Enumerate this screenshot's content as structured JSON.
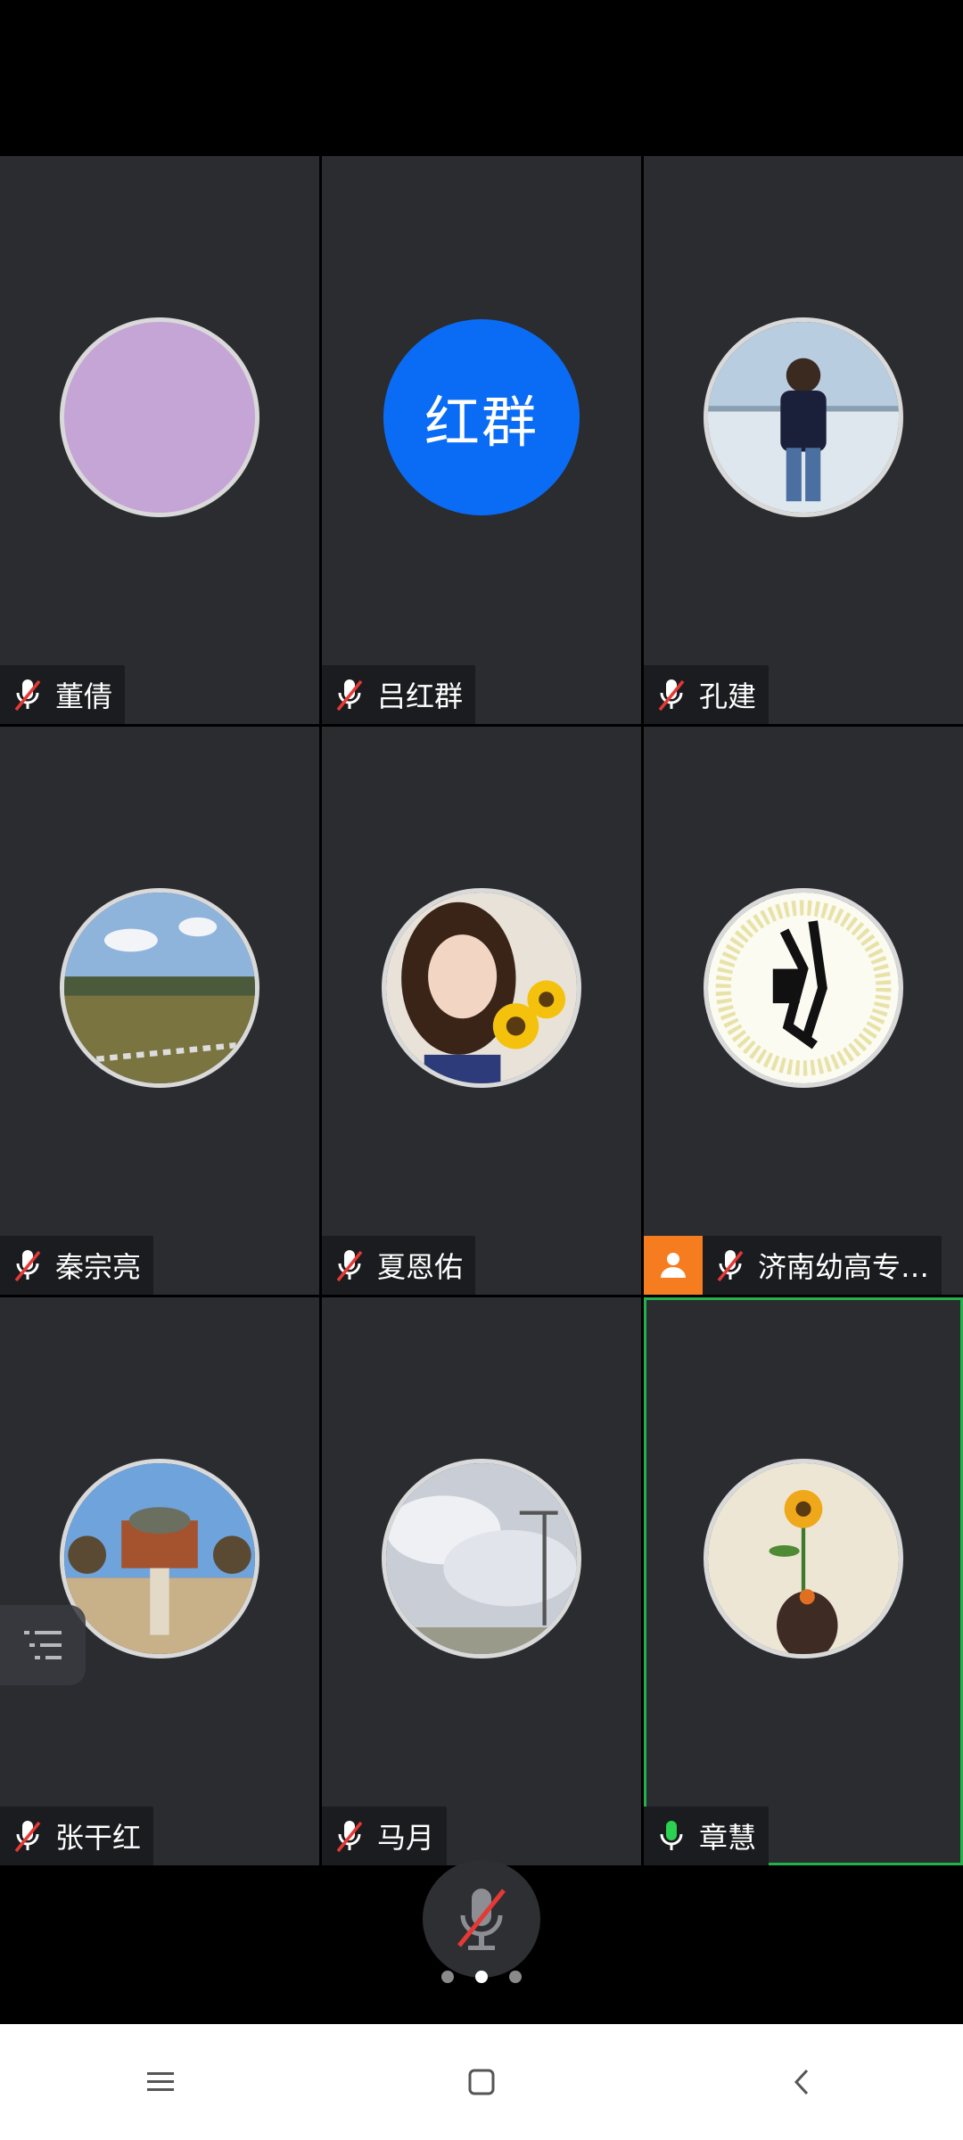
{
  "participants": [
    {
      "name": "董倩",
      "avatar": "lavender-circle",
      "muted": true
    },
    {
      "name": "吕红群",
      "avatar": "text",
      "avatar_text": "红群",
      "avatar_color": "#0a6cf5",
      "muted": true
    },
    {
      "name": "孔建",
      "avatar": "photo-man-lake",
      "muted": true
    },
    {
      "name": "秦宗亮",
      "avatar": "photo-field-sky",
      "muted": true
    },
    {
      "name": "夏恩佑",
      "avatar": "photo-girl-sunflowers",
      "muted": true
    },
    {
      "name": "济南幼高专…",
      "avatar": "logo-emblem",
      "muted": true,
      "host_badge": true
    },
    {
      "name": "张干红",
      "avatar": "photo-building",
      "muted": true
    },
    {
      "name": "马月",
      "avatar": "photo-clouds",
      "muted": true
    },
    {
      "name": "章慧",
      "avatar": "illustration-sunflower-girl",
      "muted": false,
      "active_speaker": true
    }
  ],
  "colors": {
    "tile_bg": "#2b2c30",
    "active_border": "#23b14d",
    "mic_on": "#2bd150",
    "mic_muted_slash": "#e53935",
    "host_badge": "#f57c1f"
  },
  "pager": {
    "pages": 3,
    "current": 2
  },
  "icons": {
    "list": "list-icon",
    "mic": "mic-muted-icon",
    "nav_menu": "menu-icon",
    "nav_home": "home-icon",
    "nav_back": "back-icon"
  }
}
